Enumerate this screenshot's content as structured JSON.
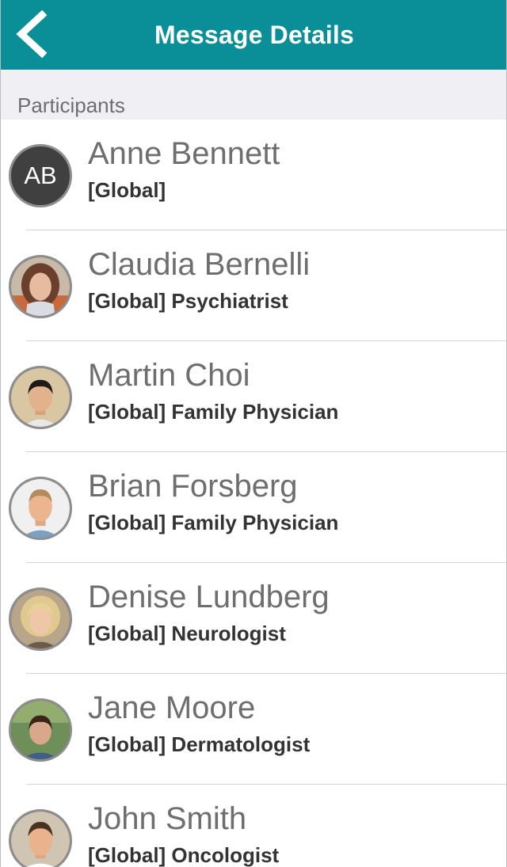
{
  "colors": {
    "accent": "#0a8f98",
    "section_bg": "#efeff4"
  },
  "navbar": {
    "title": "Message Details",
    "back_icon": "chevron-left-icon"
  },
  "section": {
    "title": "Participants"
  },
  "participants": [
    {
      "name": "Anne Bennett",
      "role": "[Global]",
      "initials": "AB"
    },
    {
      "name": "Claudia Bernelli",
      "role": "[Global] Psychiatrist"
    },
    {
      "name": "Martin Choi",
      "role": "[Global] Family Physician"
    },
    {
      "name": "Brian Forsberg",
      "role": "[Global] Family Physician"
    },
    {
      "name": "Denise Lundberg",
      "role": "[Global] Neurologist"
    },
    {
      "name": "Jane Moore",
      "role": "[Global] Dermatologist"
    },
    {
      "name": "John Smith",
      "role": "[Global] Oncologist"
    }
  ]
}
